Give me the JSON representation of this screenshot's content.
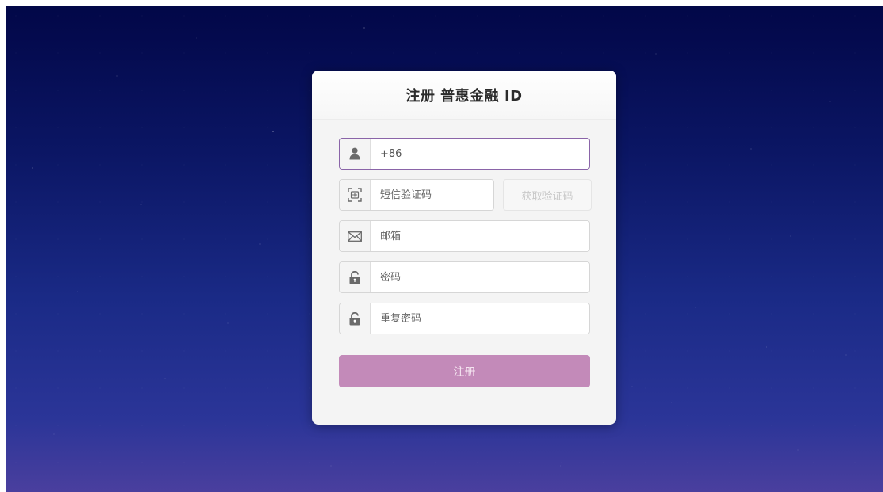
{
  "card": {
    "title": "注册 普惠金融 ID"
  },
  "form": {
    "phone": {
      "value": "+86",
      "placeholder": "",
      "icon": "user-icon"
    },
    "sms_code": {
      "value": "",
      "placeholder": "短信验证码",
      "icon": "verify-code-icon"
    },
    "get_code_label": "获取验证码",
    "email": {
      "value": "",
      "placeholder": "邮箱",
      "icon": "mail-icon"
    },
    "password": {
      "value": "",
      "placeholder": "密码",
      "icon": "lock-icon"
    },
    "confirm_password": {
      "value": "",
      "placeholder": "重复密码",
      "icon": "lock-icon"
    },
    "submit_label": "注册"
  },
  "colors": {
    "focus_border": "#8a64a8",
    "submit_button": "#c38ab9",
    "background_top": "#020748",
    "background_bottom": "#4a3f9e"
  }
}
